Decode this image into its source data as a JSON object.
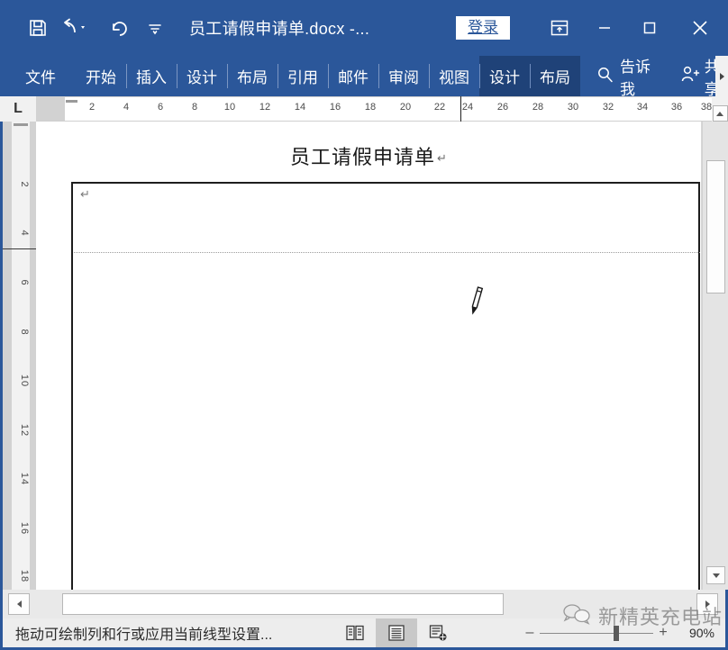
{
  "titlebar": {
    "quick_access": [
      {
        "name": "save-button",
        "icon": "save-icon",
        "label": ""
      },
      {
        "name": "undo-button",
        "icon": "undo-icon",
        "label": ""
      },
      {
        "name": "redo-button",
        "icon": "redo-icon",
        "label": ""
      },
      {
        "name": "customize-qat-button",
        "icon": "chevron-down-icon",
        "label": ""
      }
    ],
    "document_title": "员工请假申请单.docx -...",
    "signin_label": "登录",
    "ribbon_display_options_icon": "ribbon-display-options-icon",
    "minimize_label": "—",
    "restore_label": "□",
    "close_label": "✕",
    "background_color": "#2b579a"
  },
  "ribbon": {
    "tabs": [
      {
        "label": "文件",
        "active": false,
        "context": false
      },
      {
        "label": "开始",
        "active": false,
        "context": false
      },
      {
        "label": "插入",
        "active": false,
        "context": false
      },
      {
        "label": "设计",
        "active": false,
        "context": false
      },
      {
        "label": "布局",
        "active": false,
        "context": false
      },
      {
        "label": "引用",
        "active": false,
        "context": false
      },
      {
        "label": "邮件",
        "active": false,
        "context": false
      },
      {
        "label": "审阅",
        "active": false,
        "context": false
      },
      {
        "label": "视图",
        "active": false,
        "context": false
      },
      {
        "label": "设计",
        "active": true,
        "context": true
      },
      {
        "label": "布局",
        "active": false,
        "context": true
      }
    ],
    "tell_me_label": "告诉我",
    "share_label": "共享",
    "more_label": "▸",
    "context_tab_color": "#1f4278"
  },
  "ruler": {
    "tab_stop_marker": "L",
    "horizontal_ticks": [
      "2",
      "4",
      "6",
      "8",
      "10",
      "12",
      "14",
      "16",
      "18",
      "20",
      "22",
      "24",
      "26",
      "28",
      "30",
      "32",
      "34",
      "36",
      "38"
    ],
    "vertical_ticks": [
      "2",
      "4",
      "6",
      "8",
      "10",
      "12",
      "14",
      "16",
      "18"
    ],
    "right_margin_at_tick": "24"
  },
  "document": {
    "title_text": "员工请假申请单",
    "title_paragraph_mark": "↵",
    "cell_paragraph_mark": "↵",
    "cursor": "pencil-cursor",
    "table_present": true
  },
  "statusbar": {
    "message": "拖动可绘制列和行或应用当前线型设置...",
    "proofing_icon": "proofing-icon",
    "view_modes": [
      {
        "name": "read-mode",
        "icon": "read-mode-icon",
        "active": false
      },
      {
        "name": "print-layout",
        "icon": "print-layout-icon",
        "active": true
      },
      {
        "name": "web-layout",
        "icon": "web-layout-icon",
        "active": false
      }
    ],
    "zoom_out_label": "–",
    "zoom_in_label": "+",
    "zoom_percent": "90%"
  },
  "watermark": {
    "text": "新精英充电站",
    "icon": "wechat-icon"
  }
}
